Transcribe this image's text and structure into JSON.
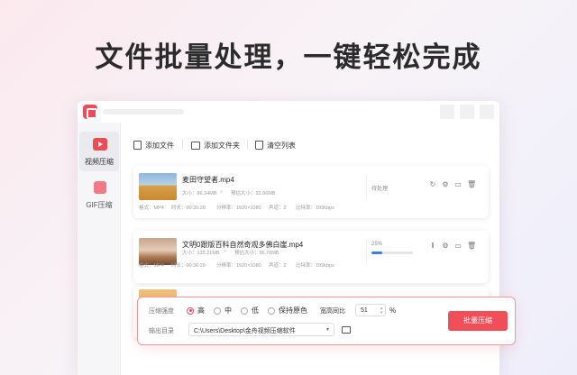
{
  "headline": "文件批量处理，一键轻松完成",
  "sidebar": {
    "items": [
      {
        "label": "视频压缩"
      },
      {
        "label": "GIF压缩"
      }
    ]
  },
  "toolbar": {
    "add_file": "添加文件",
    "add_folder": "添加文件夹",
    "clear_list": "清空列表"
  },
  "files": [
    {
      "name": "麦田守望者.mp4",
      "size": "大小：86.34MB",
      "est_size": "预估大小：32.86MB",
      "format": "格式：MP4",
      "duration": "时长：00:35:28",
      "resolution": "分辨率：1920×1080",
      "channels": "声道：2",
      "bitrate": "比特率：193kbps",
      "status": "待处理"
    },
    {
      "name": "文明0跟版百科自然奇观多佛白崖.mp4",
      "size": "大小：135.21MB",
      "est_size": "预估大小：95.76MB",
      "format": "格式：MP4",
      "duration": "时长：00:36:29",
      "resolution": "分辨率：1920×1080",
      "channels": "声道：2",
      "bitrate": "比特率：193kbps",
      "status": "25%",
      "progress": 0.25
    }
  ],
  "settings": {
    "strength_label": "压缩强度",
    "options": [
      "高",
      "中",
      "低",
      "保持原色"
    ],
    "selected": "高",
    "ratio_label": "宽高同比",
    "ratio_value": "51",
    "ratio_unit": "%",
    "output_label": "输出目录",
    "output_path": "C:\\Users\\Desktop\\金舟视频压缩软件",
    "batch_button": "批量压缩"
  },
  "colors": {
    "accent": "#f04f59",
    "progress": "#3a7bf0"
  }
}
